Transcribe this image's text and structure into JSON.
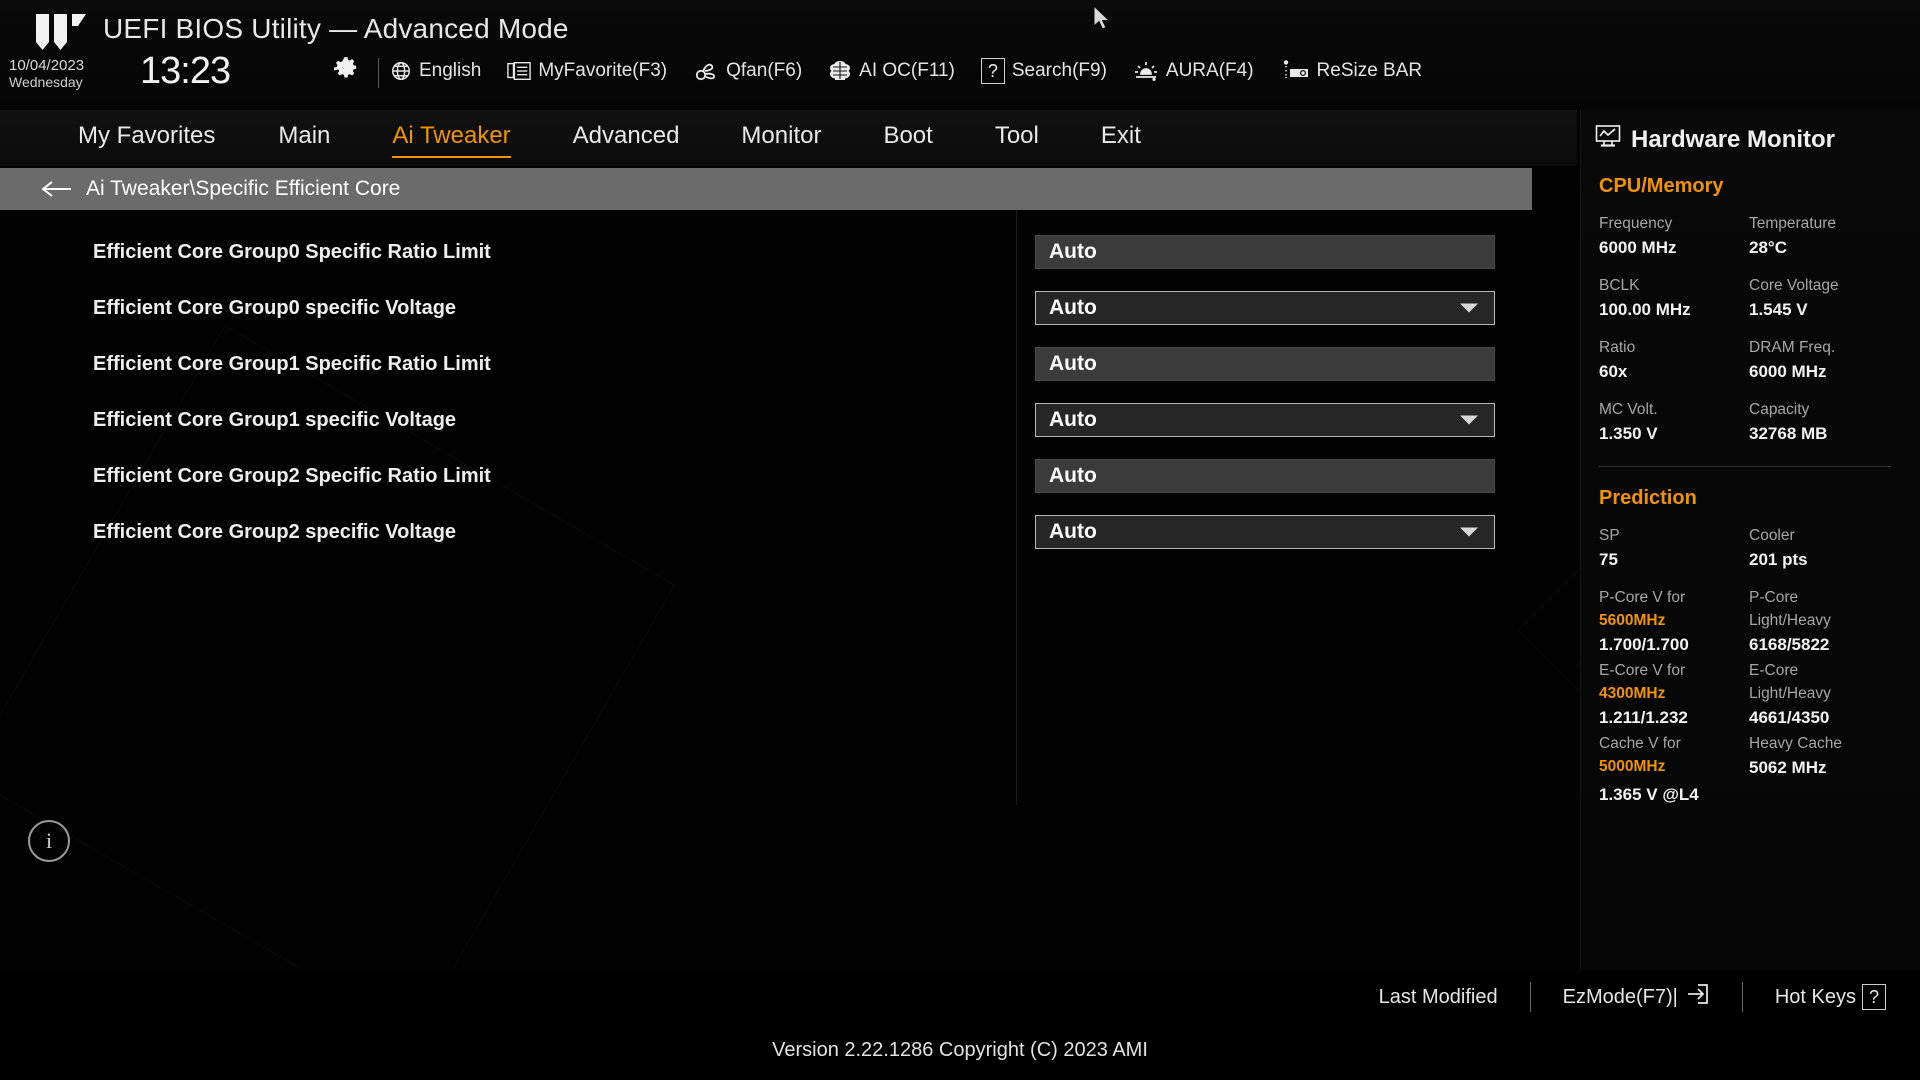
{
  "header": {
    "title": "UEFI BIOS Utility — Advanced Mode",
    "logo_icon": "tuf-gaming-logo",
    "date": "10/04/2023",
    "day_of_week": "Wednesday",
    "time": "13:23",
    "gear_icon": "gear-icon",
    "toolbar": [
      {
        "label": "English",
        "icon": "globe-icon"
      },
      {
        "label": "MyFavorite(F3)",
        "icon": "list-window-icon"
      },
      {
        "label": "Qfan(F6)",
        "icon": "fan-icon"
      },
      {
        "label": "AI OC(F11)",
        "icon": "brain-icon"
      },
      {
        "label": "Search(F9)",
        "icon": "question-box-icon"
      },
      {
        "label": "AURA(F4)",
        "icon": "lighting-icon"
      },
      {
        "label": "ReSize BAR",
        "icon": "gpu-icon"
      }
    ]
  },
  "nav": {
    "items": [
      {
        "label": "My Favorites",
        "active": false
      },
      {
        "label": "Main",
        "active": false
      },
      {
        "label": "Ai Tweaker",
        "active": true
      },
      {
        "label": "Advanced",
        "active": false
      },
      {
        "label": "Monitor",
        "active": false
      },
      {
        "label": "Boot",
        "active": false
      },
      {
        "label": "Tool",
        "active": false
      },
      {
        "label": "Exit",
        "active": false
      }
    ],
    "active_color": "#f29400"
  },
  "breadcrumb": {
    "back_icon": "arrow-left-icon",
    "path": "Ai Tweaker\\Specific Efficient Core"
  },
  "settings": {
    "rows": [
      {
        "label": "Efficient Core Group0 Specific Ratio Limit",
        "value": "Auto",
        "type": "textfield"
      },
      {
        "label": "Efficient Core Group0 specific Voltage",
        "value": "Auto",
        "type": "dropdown"
      },
      {
        "label": "Efficient Core Group1 Specific Ratio Limit",
        "value": "Auto",
        "type": "textfield"
      },
      {
        "label": "Efficient Core Group1 specific Voltage",
        "value": "Auto",
        "type": "dropdown"
      },
      {
        "label": "Efficient Core Group2 Specific Ratio Limit",
        "value": "Auto",
        "type": "textfield"
      },
      {
        "label": "Efficient Core Group2 specific Voltage",
        "value": "Auto",
        "type": "dropdown"
      }
    ],
    "info_icon": "info-icon"
  },
  "hardware_monitor": {
    "title": "Hardware Monitor",
    "title_icon": "monitor-chart-icon",
    "sections": [
      {
        "name": "CPU/Memory",
        "pairs": [
          {
            "key": "Frequency",
            "value": "6000 MHz"
          },
          {
            "key": "Temperature",
            "value": "28°C"
          },
          {
            "key": "BCLK",
            "value": "100.00 MHz"
          },
          {
            "key": "Core Voltage",
            "value": "1.545 V"
          },
          {
            "key": "Ratio",
            "value": "60x"
          },
          {
            "key": "DRAM Freq.",
            "value": "6000 MHz"
          },
          {
            "key": "MC Volt.",
            "value": "1.350 V"
          },
          {
            "key": "Capacity",
            "value": "32768 MB"
          }
        ]
      },
      {
        "name": "Prediction",
        "pairs": [
          {
            "key": "SP",
            "value": "75"
          },
          {
            "key": "Cooler",
            "value": "201 pts"
          }
        ],
        "prediction_rows": [
          {
            "left_key": "P-Core V for",
            "left_key_accent": "5600MHz",
            "left_value": "1.700/1.700",
            "right_key": "P-Core",
            "right_key2": "Light/Heavy",
            "right_value": "6168/5822"
          },
          {
            "left_key": "E-Core V for",
            "left_key_accent": "4300MHz",
            "left_value": "1.211/1.232",
            "right_key": "E-Core",
            "right_key2": "Light/Heavy",
            "right_value": "4661/4350"
          },
          {
            "left_key": "Cache V for",
            "left_key_accent": "5000MHz",
            "left_value": "1.365 V @L4",
            "right_key": "Heavy Cache",
            "right_key2": "",
            "right_value": "5062 MHz"
          }
        ]
      }
    ],
    "accent_color": "#f29400"
  },
  "footer": {
    "last_modified": "Last Modified",
    "ezmode": "EzMode(F7)|",
    "ezmode_icon": "exit-arrow-icon",
    "hotkeys": "Hot Keys",
    "hotkeys_key": "?",
    "version": "Version 2.22.1286 Copyright (C) 2023 AMI"
  }
}
